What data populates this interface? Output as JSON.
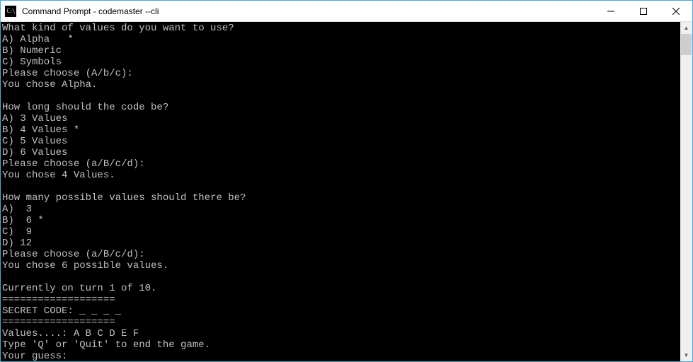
{
  "window": {
    "title": "Command Prompt - codemaster  --cli",
    "icon_text": "C:\\"
  },
  "console": {
    "lines": [
      "What kind of values do you want to use?",
      "A) Alpha   *",
      "B) Numeric",
      "C) Symbols",
      "Please choose (A/b/c):",
      "You chose Alpha.",
      "",
      "How long should the code be?",
      "A) 3 Values",
      "B) 4 Values *",
      "C) 5 Values",
      "D) 6 Values",
      "Please choose (a/B/c/d):",
      "You chose 4 Values.",
      "",
      "How many possible values should there be?",
      "A)  3",
      "B)  6 *",
      "C)  9",
      "D) 12",
      "Please choose (a/B/c/d):",
      "You chose 6 possible values.",
      "",
      "Currently on turn 1 of 10.",
      "===================",
      "SECRET CODE: _ _ _ _",
      "===================",
      "Values....: A B C D E F",
      "Type 'Q' or 'Quit' to end the game.",
      "Your guess:"
    ]
  }
}
